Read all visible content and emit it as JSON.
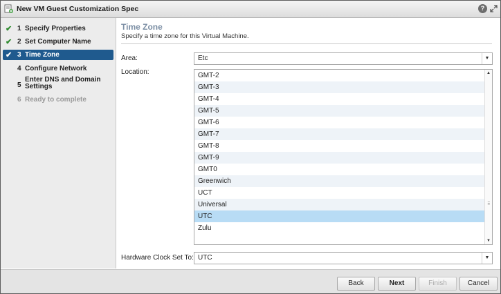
{
  "window": {
    "title": "New VM Guest Customization Spec",
    "help_icon": "?"
  },
  "steps": [
    {
      "num": "1",
      "label": "Specify Properties",
      "state": "done"
    },
    {
      "num": "2",
      "label": "Set Computer Name",
      "state": "done"
    },
    {
      "num": "3",
      "label": "Time Zone",
      "state": "active"
    },
    {
      "num": "4",
      "label": "Configure Network",
      "state": "pending"
    },
    {
      "num": "5",
      "label": "Enter DNS and Domain Settings",
      "state": "pending"
    },
    {
      "num": "6",
      "label": "Ready to complete",
      "state": "disabled"
    }
  ],
  "main": {
    "title": "Time Zone",
    "subtitle": "Specify a time zone for this Virtual Machine.",
    "area_label": "Area:",
    "area_value": "Etc",
    "location_label": "Location:",
    "locations": [
      "GMT-2",
      "GMT-3",
      "GMT-4",
      "GMT-5",
      "GMT-6",
      "GMT-7",
      "GMT-8",
      "GMT-9",
      "GMT0",
      "Greenwich",
      "UCT",
      "Universal",
      "UTC",
      "Zulu"
    ],
    "selected_location": "UTC",
    "hw_clock_label": "Hardware Clock Set To:",
    "hw_clock_value": "UTC"
  },
  "footer": {
    "back": "Back",
    "next": "Next",
    "finish": "Finish",
    "cancel": "Cancel"
  },
  "colors": {
    "accent": "#1f5a8e",
    "check": "#2e8b2e",
    "selected_row": "#b8dcf5"
  },
  "icons": {
    "check": "✔",
    "dropdown": "▼",
    "scroll_up": "▲",
    "scroll_down": "▼",
    "grip": "⠿"
  }
}
